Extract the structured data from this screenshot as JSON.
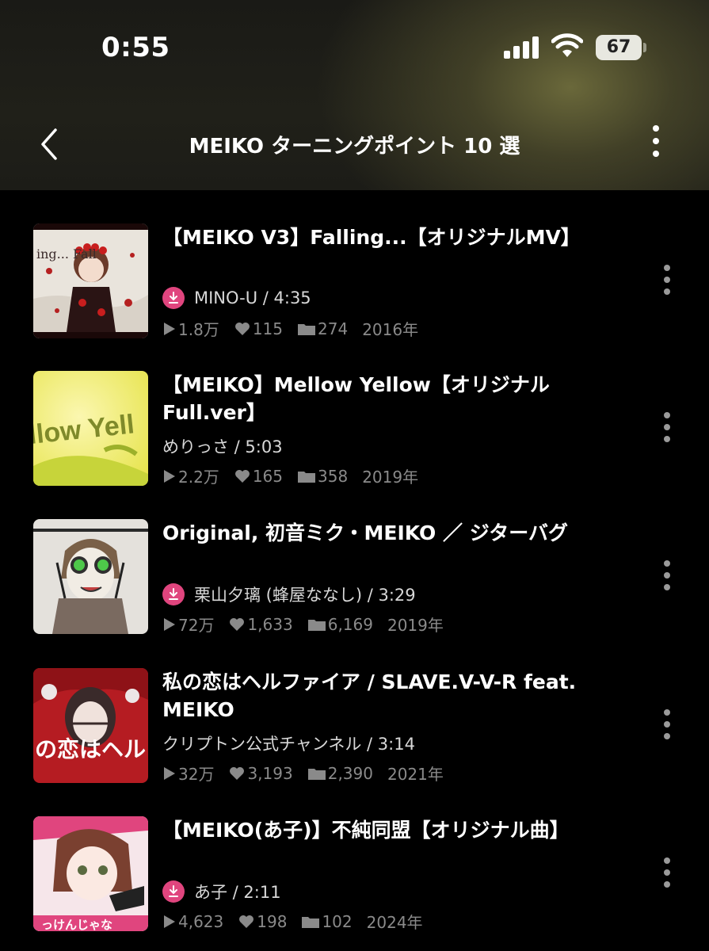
{
  "status": {
    "time": "0:55",
    "battery": "67"
  },
  "nav": {
    "title": "MEIKO ターニングポイント 10 選"
  },
  "items": [
    {
      "title": "【MEIKO V3】Falling...【オリジナルMV】",
      "author": "MINO-U",
      "duration": "4:35",
      "byline": "MINO-U / 4:35",
      "downloaded": true,
      "plays": "1.8万",
      "likes": "115",
      "mylist": "274",
      "year": "2016年",
      "thumb_text": "ing... Fall"
    },
    {
      "title": "【MEIKO】Mellow Yellow【オリジナル Full.ver】",
      "author": "めりっさ",
      "duration": "5:03",
      "byline": "めりっさ / 5:03",
      "downloaded": false,
      "plays": "2.2万",
      "likes": "165",
      "mylist": "358",
      "year": "2019年",
      "thumb_text": "llow Yell"
    },
    {
      "title": "Original, 初音ミク・MEIKO ／ ジターバグ",
      "author": "栗山夕璃 (蜂屋ななし)",
      "duration": "3:29",
      "byline": "栗山夕璃 (蜂屋ななし) / 3:29",
      "downloaded": true,
      "plays": "72万",
      "likes": "1,633",
      "mylist": "6,169",
      "year": "2019年",
      "thumb_text": ""
    },
    {
      "title": "私の恋はヘルファイア / SLAVE.V-V-R feat. MEIKO",
      "author": "クリプトン公式チャンネル",
      "duration": "3:14",
      "byline": "クリプトン公式チャンネル / 3:14",
      "downloaded": false,
      "plays": "32万",
      "likes": "3,193",
      "mylist": "2,390",
      "year": "2021年",
      "thumb_text": "の恋はヘルファイ"
    },
    {
      "title": "【MEIKO(あ子)】不純同盟【オリジナル曲】",
      "author": "あ子",
      "duration": "2:11",
      "byline": "あ子 / 2:11",
      "downloaded": true,
      "plays": "4,623",
      "likes": "198",
      "mylist": "102",
      "year": "2024年",
      "thumb_text": "っけんじゃな"
    }
  ],
  "colors": {
    "accent": "#e0457e",
    "stat": "#8a8a8a"
  }
}
